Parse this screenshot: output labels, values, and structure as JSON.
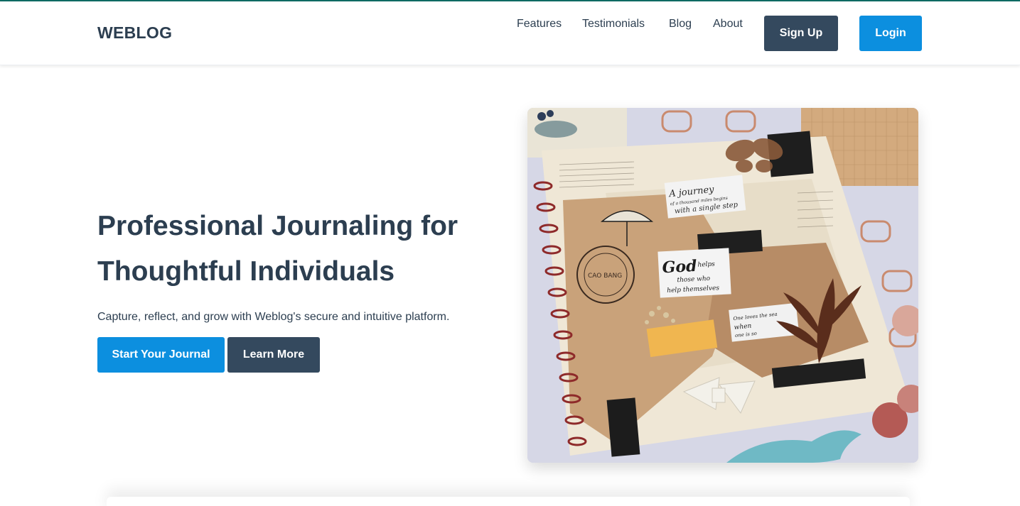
{
  "brand": {
    "name": "WEBLOG"
  },
  "nav": {
    "links": [
      "Features",
      "Testimonials",
      "Blog",
      "About"
    ],
    "signup_label": "Sign Up",
    "login_label": "Login"
  },
  "hero": {
    "title_line1": "Professional Journaling for",
    "title_line2": "Thoughtful Individuals",
    "subtitle": "Capture, reflect, and grow with Weblog's secure and intuitive platform.",
    "primary_cta": "Start Your Journal",
    "secondary_cta": "Learn More",
    "image": {
      "texts": [
        "A journey",
        "of a thousand miles begins",
        "with a single step",
        "God",
        "helps",
        "those who",
        "help themselves",
        "CAO BANG",
        "One loves the sea",
        "when",
        "one is so"
      ]
    }
  },
  "colors": {
    "primary_text": "#2c3e50",
    "accent_blue": "#0c8fdf",
    "dark_button": "#34495e",
    "top_accent": "#0f6b63"
  }
}
